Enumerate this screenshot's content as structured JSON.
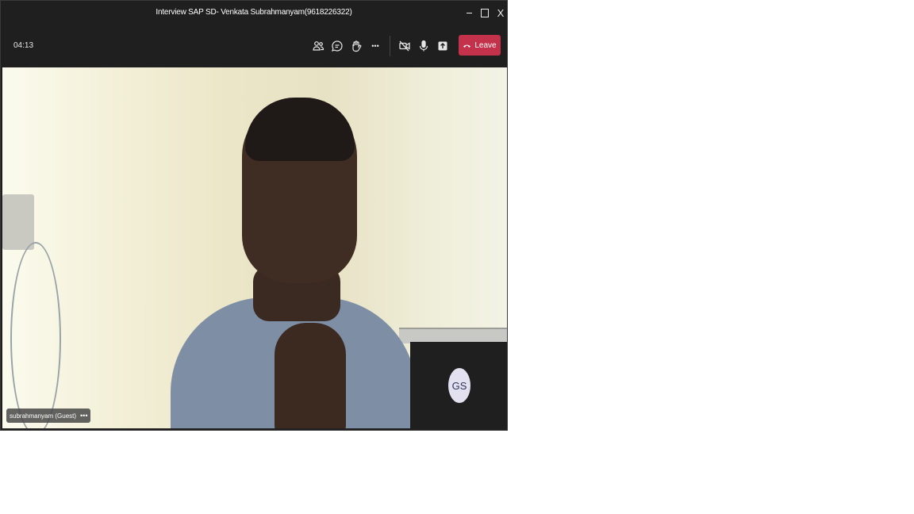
{
  "window": {
    "title": "Interview SAP SD- Venkata Subrahmanyam(9618226322)",
    "controls": {
      "minimize_icon": "minimize-icon",
      "maximize_icon": "maximize-icon",
      "close_label": "X"
    }
  },
  "toolbar": {
    "timer": "04:13",
    "icons": [
      "people-icon",
      "chat-icon",
      "raise-hand-icon",
      "more-icon",
      "camera-off-icon",
      "mic-icon",
      "share-icon"
    ],
    "more_label": "•••",
    "leave_label": "Leave",
    "leave_color": "#c4314b"
  },
  "stage": {
    "participant_name": "subrahmanyam (Guest)",
    "participant_more": "•••"
  },
  "self_view": {
    "initials": "GS"
  }
}
